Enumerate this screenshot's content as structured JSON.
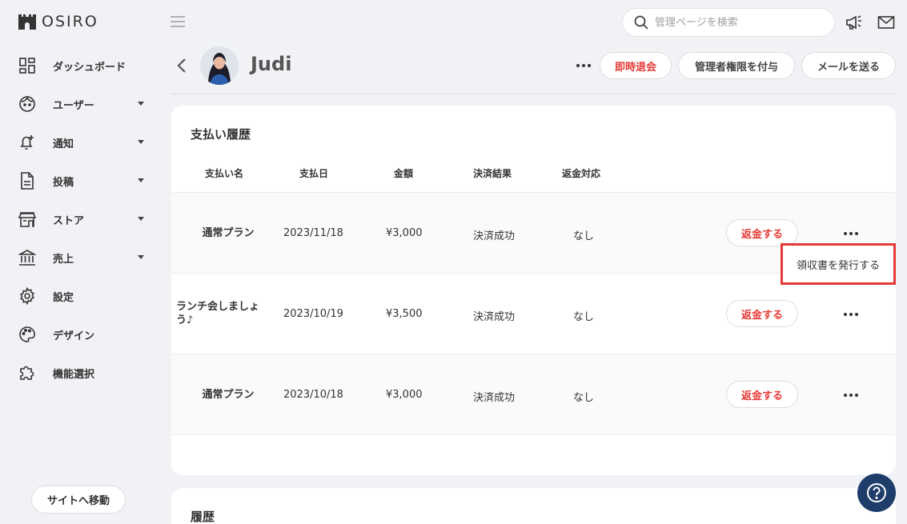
{
  "brand": {
    "name": "OSIRO"
  },
  "sidebar": {
    "items": [
      {
        "label": "ダッシュボード",
        "icon": "dashboard-icon",
        "has_caret": false
      },
      {
        "label": "ユーザー",
        "icon": "user-face-icon",
        "has_caret": true
      },
      {
        "label": "通知",
        "icon": "bell-plus-icon",
        "has_caret": true
      },
      {
        "label": "投稿",
        "icon": "document-icon",
        "has_caret": true
      },
      {
        "label": "ストア",
        "icon": "store-icon",
        "has_caret": true
      },
      {
        "label": "売上",
        "icon": "bank-icon",
        "has_caret": true
      },
      {
        "label": "設定",
        "icon": "gear-icon",
        "has_caret": false
      },
      {
        "label": "デザイン",
        "icon": "palette-icon",
        "has_caret": false
      },
      {
        "label": "機能選択",
        "icon": "puzzle-icon",
        "has_caret": false
      }
    ],
    "site_button": "サイトへ移動"
  },
  "topbar": {
    "search_placeholder": "管理ページを検索",
    "icons": [
      "announcement-icon",
      "mail-icon"
    ]
  },
  "header": {
    "username": "Judi",
    "buttons": {
      "withdraw": "即時退会",
      "grant_admin": "管理者権限を付与",
      "send_mail": "メールを送る"
    }
  },
  "payments": {
    "title": "支払い履歴",
    "columns": [
      "支払い名",
      "支払日",
      "金額",
      "決済結果",
      "返金対応"
    ],
    "rows": [
      {
        "name": "通常プラン",
        "date": "2023/11/18",
        "amount": "¥3,000",
        "result": "決済成功",
        "refund_status": "なし",
        "refund_button": "返金する"
      },
      {
        "name": "ランチ会しましょう♪",
        "date": "2023/10/19",
        "amount": "¥3,500",
        "result": "決済成功",
        "refund_status": "なし",
        "refund_button": "返金する"
      },
      {
        "name": "通常プラン",
        "date": "2023/10/18",
        "amount": "¥3,000",
        "result": "決済成功",
        "refund_status": "なし",
        "refund_button": "返金する"
      }
    ],
    "popup_menu_item": "領収書を発行する"
  },
  "history": {
    "title": "履歴"
  },
  "colors": {
    "accent_red": "#e53935",
    "help_bg": "#1e3d6b",
    "page_bg": "#f1f2f5"
  }
}
